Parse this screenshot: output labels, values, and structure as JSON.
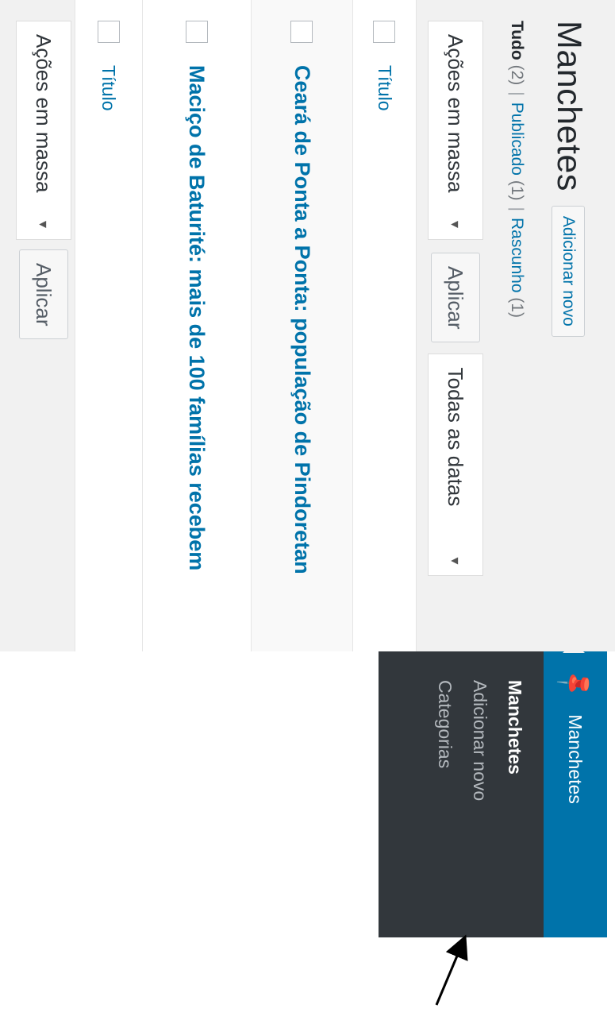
{
  "header": {
    "title": "Manchetes",
    "add_new_label": "Adicionar novo"
  },
  "views": {
    "all_label": "Tudo",
    "all_count": "(2)",
    "published_label": "Publicado",
    "published_count": "(1)",
    "draft_label": "Rascunho",
    "draft_count": "(1)",
    "separator": "|"
  },
  "top_actions": {
    "bulk_select_value": "Ações em massa",
    "apply_label": "Aplicar",
    "date_select_value": "Todas as datas",
    "caret": "▾"
  },
  "table": {
    "column_title": "Título",
    "rows": [
      {
        "title": "Ceará de Ponta a Ponta: população de Pindoretan"
      },
      {
        "title": "Maciço de Baturité: mais de 100 famílias recebem"
      }
    ]
  },
  "bottom_actions": {
    "bulk_select_value": "Ações em massa",
    "apply_label": "Aplicar",
    "caret": "▾"
  },
  "sidebar": {
    "top_item": {
      "label": "Manchetes",
      "icon": "pin-icon"
    },
    "submenu": [
      {
        "label": "Manchetes",
        "current": true
      },
      {
        "label": "Adicionar novo",
        "current": false
      },
      {
        "label": "Categorias",
        "current": false
      }
    ]
  },
  "colors": {
    "accent": "#0073aa",
    "menu_bg": "#32373c",
    "content_bg": "#f1f1f1",
    "link": "#0073aa"
  }
}
